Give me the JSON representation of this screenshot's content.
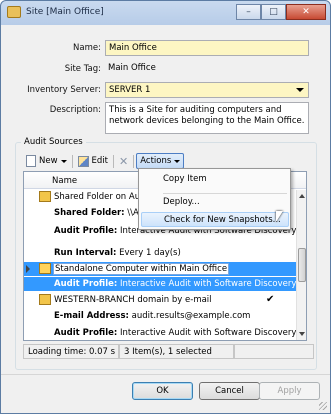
{
  "window": {
    "title": "Site [Main Office]",
    "minimize_glyph": "–",
    "maximize_glyph": "□",
    "close_glyph": "✕"
  },
  "form": {
    "name_label": "Name:",
    "name_value": "Main Office",
    "site_tag_label": "Site Tag:",
    "site_tag_value": "Main Office",
    "inventory_server_label": "Inventory Server:",
    "inventory_server_value": "SERVER 1",
    "description_label": "Description:",
    "description_value": "This is a Site for auditing computers and network devices belonging to the Main Office."
  },
  "audit_sources": {
    "group_label": "Audit Sources",
    "toolbar": {
      "new_label": "New",
      "edit_label": "Edit",
      "actions_label": "Actions"
    },
    "column_name": "Name",
    "rows": [
      {
        "text": "Shared Folder on AuditS",
        "kind": "item"
      },
      {
        "label": "Shared Folder:",
        "value": "\\\\AUI",
        "kind": "detail"
      },
      {
        "label": "Audit Profile:",
        "value": "Interactive Audit with Software Discovery in Files",
        "kind": "detail"
      },
      {
        "label": "Run Interval:",
        "value": "Every 1 day(s)",
        "kind": "detail"
      },
      {
        "text": "Standalone Computer within Main Office",
        "kind": "item-selected"
      },
      {
        "label": "Audit Profile:",
        "value": "Interactive Audit with Software Discovery in Files",
        "kind": "detail-selected"
      },
      {
        "text": "WESTERN-BRANCH domain by e-mail",
        "kind": "item",
        "check": "✔"
      },
      {
        "label": "E-mail Address:",
        "value": "audit.results@example.com",
        "kind": "detail"
      },
      {
        "label": "Audit Profile:",
        "value": "Interactive Audit with Software Discovery in Files",
        "kind": "detail"
      }
    ],
    "status": {
      "loading_time": "Loading time: 0.07 s",
      "items": "3 Item(s), 1 selected"
    }
  },
  "actions_menu": {
    "items": [
      "Copy Item",
      "Deploy...",
      "Check for New Snapshots..."
    ],
    "highlighted_index": 2
  },
  "buttons": {
    "ok": "OK",
    "cancel": "Cancel",
    "apply": "Apply"
  }
}
